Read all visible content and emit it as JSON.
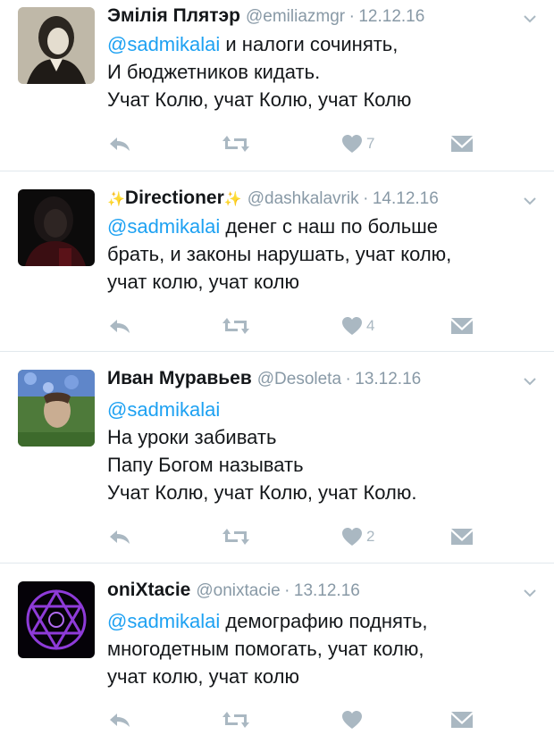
{
  "tweets": [
    {
      "name": "Эмілія Плятэр",
      "handle": "@emiliazmgr",
      "date": "12.12.16",
      "mention": "@sadmikalai",
      "lines": [
        "и налоги сочинять,",
        "И бюджетников кидать.",
        "Учат Колю, учат Колю, учат Колю"
      ],
      "likes": "7"
    },
    {
      "name": "Directioner",
      "name_prefix": "✨",
      "name_suffix": "✨",
      "handle": "@dashkalavrik",
      "date": "14.12.16",
      "mention": "@sadmikalai",
      "lines": [
        "денег с наш по больше",
        "брать, и законы нарушать, учат колю,",
        "учат колю, учат колю"
      ],
      "likes": "4"
    },
    {
      "name": "Иван Муравьев",
      "handle": "@Desoleta",
      "date": "13.12.16",
      "mention": "@sadmikalai",
      "lines": [
        "",
        "На уроки забивать",
        "Папу Богом называть",
        "Учат Колю, учат Колю, учат Колю."
      ],
      "likes": "2"
    },
    {
      "name": "oniXtacie",
      "handle": "@onixtacie",
      "date": "13.12.16",
      "mention": "@sadmikalai",
      "lines": [
        "демографию поднять,",
        "многодетным помогать, учат колю,",
        "учат колю, учат колю"
      ],
      "likes": ""
    }
  ],
  "separator": "·",
  "colors": {
    "text": "#14171a",
    "mention": "#1da1f2",
    "muted": "#8899a6",
    "icon": "#aab8c2",
    "divider": "#e1e8ed",
    "avatar_purple": "#8e3bd8"
  },
  "icons": [
    "reply-icon",
    "retweet-icon",
    "like-icon",
    "direct-message-icon",
    "chevron-down-icon"
  ]
}
